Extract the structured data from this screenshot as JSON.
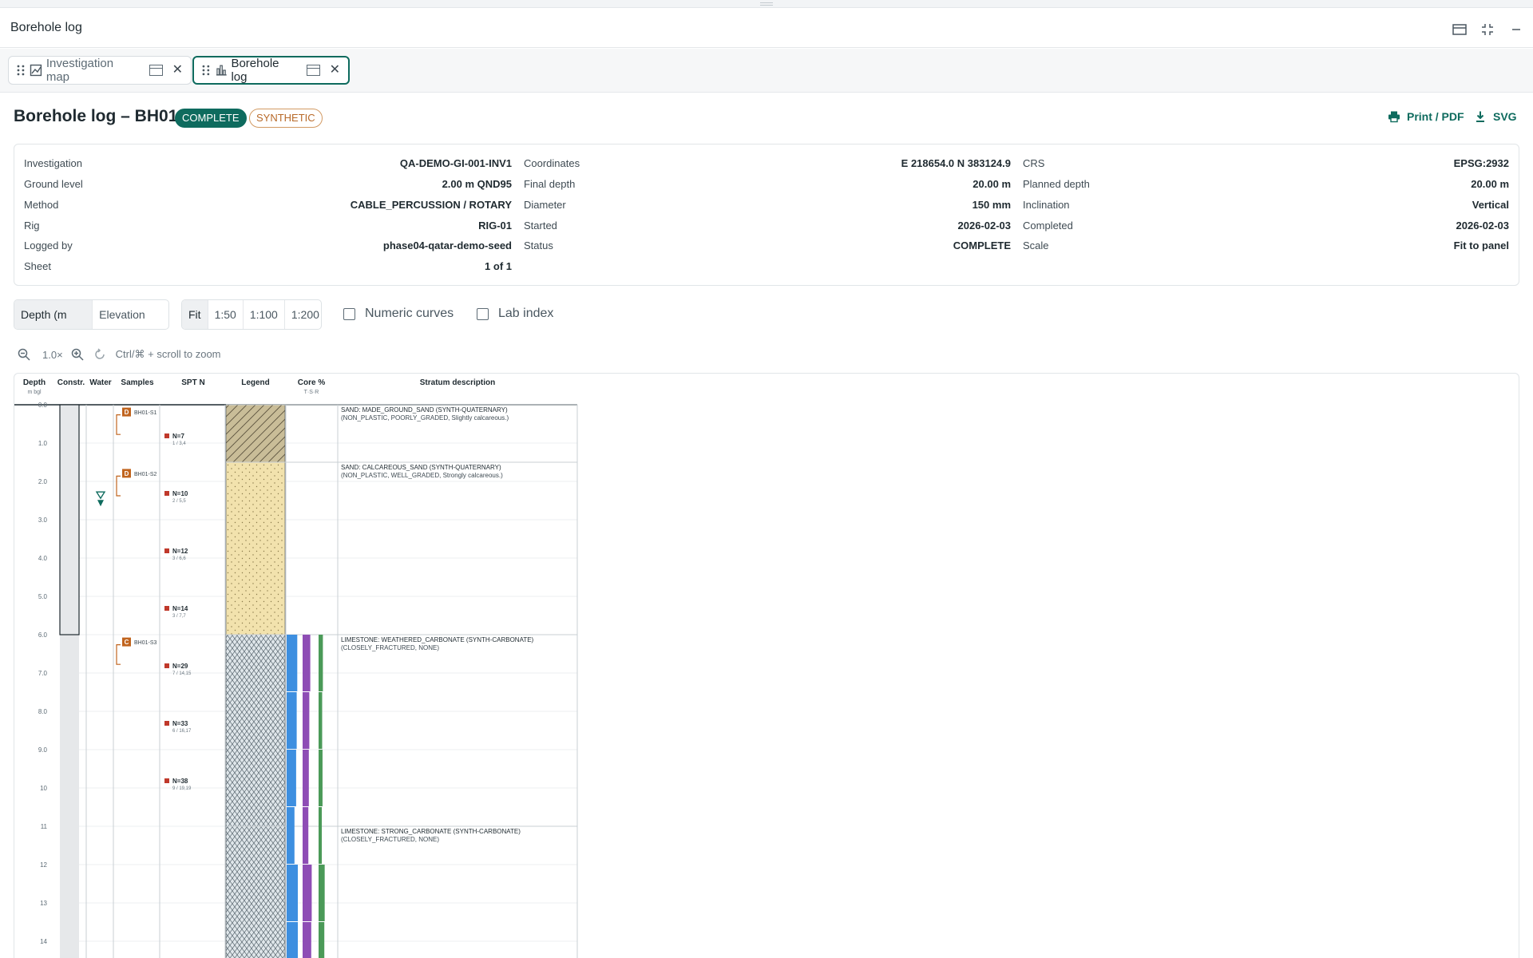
{
  "window": {
    "title": "Borehole log"
  },
  "tabs": [
    {
      "label": "Investigation map",
      "icon": "map-icon",
      "active": false
    },
    {
      "label": "Borehole log",
      "icon": "bar-chart-icon",
      "active": true
    }
  ],
  "header": {
    "title": "Borehole log – BH01",
    "badges": {
      "status": "COMPLETE",
      "synthetic": "SYNTHETIC"
    },
    "actions": {
      "print": "Print / PDF",
      "svg": "SVG"
    }
  },
  "meta": {
    "col1": [
      {
        "label": "Investigation",
        "value": "QA-DEMO-GI-001-INV1"
      },
      {
        "label": "Ground level",
        "value": "2.00 m QND95"
      },
      {
        "label": "Method",
        "value": "CABLE_PERCUSSION / ROTARY"
      },
      {
        "label": "Rig",
        "value": "RIG-01"
      },
      {
        "label": "Logged by",
        "value": "phase04-qatar-demo-seed"
      },
      {
        "label": "Sheet",
        "value": "1 of 1"
      }
    ],
    "col2": [
      {
        "label": "Coordinates",
        "value": "E 218654.0 N 383124.9"
      },
      {
        "label": "Final depth",
        "value": "20.00 m"
      },
      {
        "label": "Diameter",
        "value": "150 mm"
      },
      {
        "label": "Started",
        "value": "2026-02-03"
      },
      {
        "label": "Status",
        "value": "COMPLETE"
      }
    ],
    "col3": [
      {
        "label": "CRS",
        "value": "EPSG:2932"
      },
      {
        "label": "Planned depth",
        "value": "20.00 m"
      },
      {
        "label": "Inclination",
        "value": "Vertical"
      },
      {
        "label": "Completed",
        "value": "2026-02-03"
      },
      {
        "label": "Scale",
        "value": "Fit to panel"
      }
    ]
  },
  "controls": {
    "axis_mode": [
      "Depth (m bgl)",
      "Elevation (m)"
    ],
    "axis_selected": "Depth (m bgl)",
    "scales": [
      "Fit",
      "1:50",
      "1:100",
      "1:200"
    ],
    "scale_selected": "Fit",
    "numeric_curves": {
      "label": "Numeric curves",
      "checked": false
    },
    "lab_index": {
      "label": "Lab index",
      "checked": false
    },
    "zoom_level": "1.0×",
    "zoom_hint": "Ctrl/⌘ + scroll to zoom"
  },
  "log": {
    "columns": {
      "depth": "Depth",
      "depth_sub": "m bgl",
      "constr": "Constr.",
      "water": "Water",
      "samples": "Samples",
      "spt": "SPT N",
      "legend": "Legend",
      "core": "Core %",
      "core_sub": "T·S·R",
      "desc": "Stratum description"
    },
    "depth_ticks": [
      "0.0",
      "1.0",
      "2.0",
      "3.0",
      "4.0",
      "5.0",
      "6.0",
      "7.0",
      "8.0",
      "9.0",
      "10",
      "11",
      "12",
      "13",
      "14"
    ],
    "visible_max_depth": 14.5,
    "construction": {
      "top": 0,
      "base": 6
    },
    "water_strike": 2.4,
    "samples": [
      {
        "type": "D",
        "id": "BH01-S1",
        "top": 0.2,
        "base": 0.65
      },
      {
        "type": "D",
        "id": "BH01-S2",
        "top": 1.8,
        "base": 2.25
      },
      {
        "type": "C",
        "id": "BH01-S3",
        "top": 6.2,
        "base": 6.65
      }
    ],
    "spt": [
      {
        "depth": 1.0,
        "label": "N=7",
        "sub": "1 / 3,4"
      },
      {
        "depth": 2.5,
        "label": "N=10",
        "sub": "2 / 5,5"
      },
      {
        "depth": 4.0,
        "label": "N=12",
        "sub": "3 / 6,6"
      },
      {
        "depth": 5.5,
        "label": "N=14",
        "sub": "3 / 7,7"
      },
      {
        "depth": 7.0,
        "label": "N=29",
        "sub": "7 / 14,15"
      },
      {
        "depth": 8.5,
        "label": "N=33",
        "sub": "6 / 16,17"
      },
      {
        "depth": 10.0,
        "label": "N=38",
        "sub": "9 / 19,19"
      }
    ],
    "strata": [
      {
        "top": 0,
        "base": 1.5,
        "pattern": "made-ground",
        "line1": "SAND: MADE_GROUND_SAND (SYNTH-QUATERNARY)",
        "line2": "(NON_PLASTIC, POORLY_GRADED, Slightly calcareous.)"
      },
      {
        "top": 1.5,
        "base": 6.0,
        "pattern": "sand",
        "line1": "SAND: CALCAREOUS_SAND (SYNTH-QUATERNARY)",
        "line2": "(NON_PLASTIC, WELL_GRADED, Strongly calcareous.)"
      },
      {
        "top": 6.0,
        "base": 11.0,
        "pattern": "limestone",
        "line1": "LIMESTONE: WEATHERED_CARBONATE (SYNTH-CARBONATE)",
        "line2": "(CLOSELY_FRACTURED, NONE)"
      },
      {
        "top": 11.0,
        "base": 14.5,
        "pattern": "limestone",
        "line1": "LIMESTONE: STRONG_CARBONATE (SYNTH-CARBONATE)",
        "line2": "(CLOSELY_FRACTURED, NONE)"
      }
    ],
    "core_runs": [
      {
        "top": 6.0,
        "base": 7.5,
        "tcr": 95,
        "scr": 80,
        "rqd": 60
      },
      {
        "top": 7.5,
        "base": 9.0,
        "tcr": 90,
        "scr": 70,
        "rqd": 50
      },
      {
        "top": 9.0,
        "base": 10.5,
        "tcr": 85,
        "scr": 65,
        "rqd": 55
      },
      {
        "top": 10.5,
        "base": 12.0,
        "tcr": 70,
        "scr": 60,
        "rqd": 45
      },
      {
        "top": 12.0,
        "base": 13.5,
        "tcr": 100,
        "scr": 95,
        "rqd": 85
      },
      {
        "top": 13.5,
        "base": 14.5,
        "tcr": 100,
        "scr": 90,
        "rqd": 80
      }
    ],
    "colors": {
      "tcr": "#3d8fe0",
      "scr": "#8e4db5",
      "rqd": "#4b9a58",
      "spt": "#c0392b",
      "sample_box": "#c0641e",
      "water": "#0e6b5e",
      "made_ground_bg": "#c9bd98",
      "sand_bg": "#f2e2ad",
      "limestone_bg": "#dfe6ea"
    }
  }
}
